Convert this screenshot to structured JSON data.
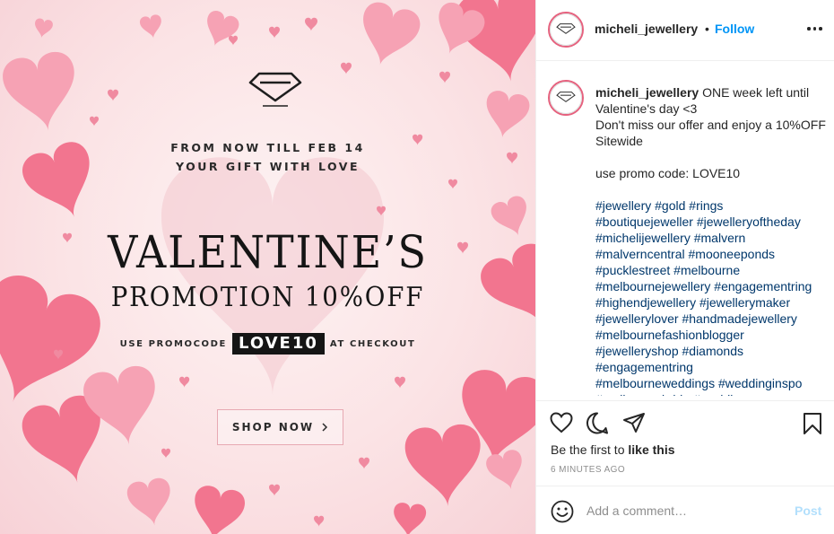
{
  "promo": {
    "line1": "FROM NOW TILL FEB 14",
    "line2": "YOUR GIFT WITH LOVE",
    "title": "VALENTINE’S",
    "subtitle": "PROMOTION 10%OFF",
    "code_prefix": "USE PROMOCODE",
    "code": "LOVE10",
    "code_suffix": "AT CHECKOUT",
    "shop_button": "SHOP NOW",
    "colors": {
      "heart_pink": "#f06f8d",
      "heart_light": "#f7a9b8",
      "background": "#fbe3e5"
    }
  },
  "header": {
    "username": "micheli_jewellery",
    "separator": "•",
    "follow_label": "Follow",
    "avatar_icon": "diamond-icon",
    "more_icon": "more-options-icon"
  },
  "caption": {
    "username": "micheli_jewellery",
    "lines": [
      "ONE week left until Valentine's day <3",
      "Don't miss our offer and enjoy a 10%OFF Sitewide",
      "",
      "use promo code: LOVE10",
      ""
    ],
    "hashtag_lines": [
      "#jewellery #gold #rings",
      "#boutiquejeweller #jewelleryoftheday",
      "#michelijewellery #malvern",
      "#malverncentral #mooneeponds",
      "#pucklestreet #melbourne",
      "#melbournejewellery #engagementring",
      "#highendjewellery #jewellerymaker",
      "#jewellerylover #handmadejewellery",
      "#melbournefashionblogger",
      "#jewelleryshop #diamonds",
      "#engagementring",
      "#melbourneweddings #weddinginspo",
      "#melbournebride #wedding"
    ]
  },
  "actions": {
    "icons": [
      "heart-icon",
      "comment-icon",
      "share-icon",
      "bookmark-icon"
    ],
    "likes_prefix": "Be the first to ",
    "likes_link": "like this",
    "timestamp": "6 MINUTES AGO"
  },
  "comment": {
    "placeholder": "Add a comment…",
    "post_label": "Post",
    "emoji_icon": "emoji-icon"
  }
}
